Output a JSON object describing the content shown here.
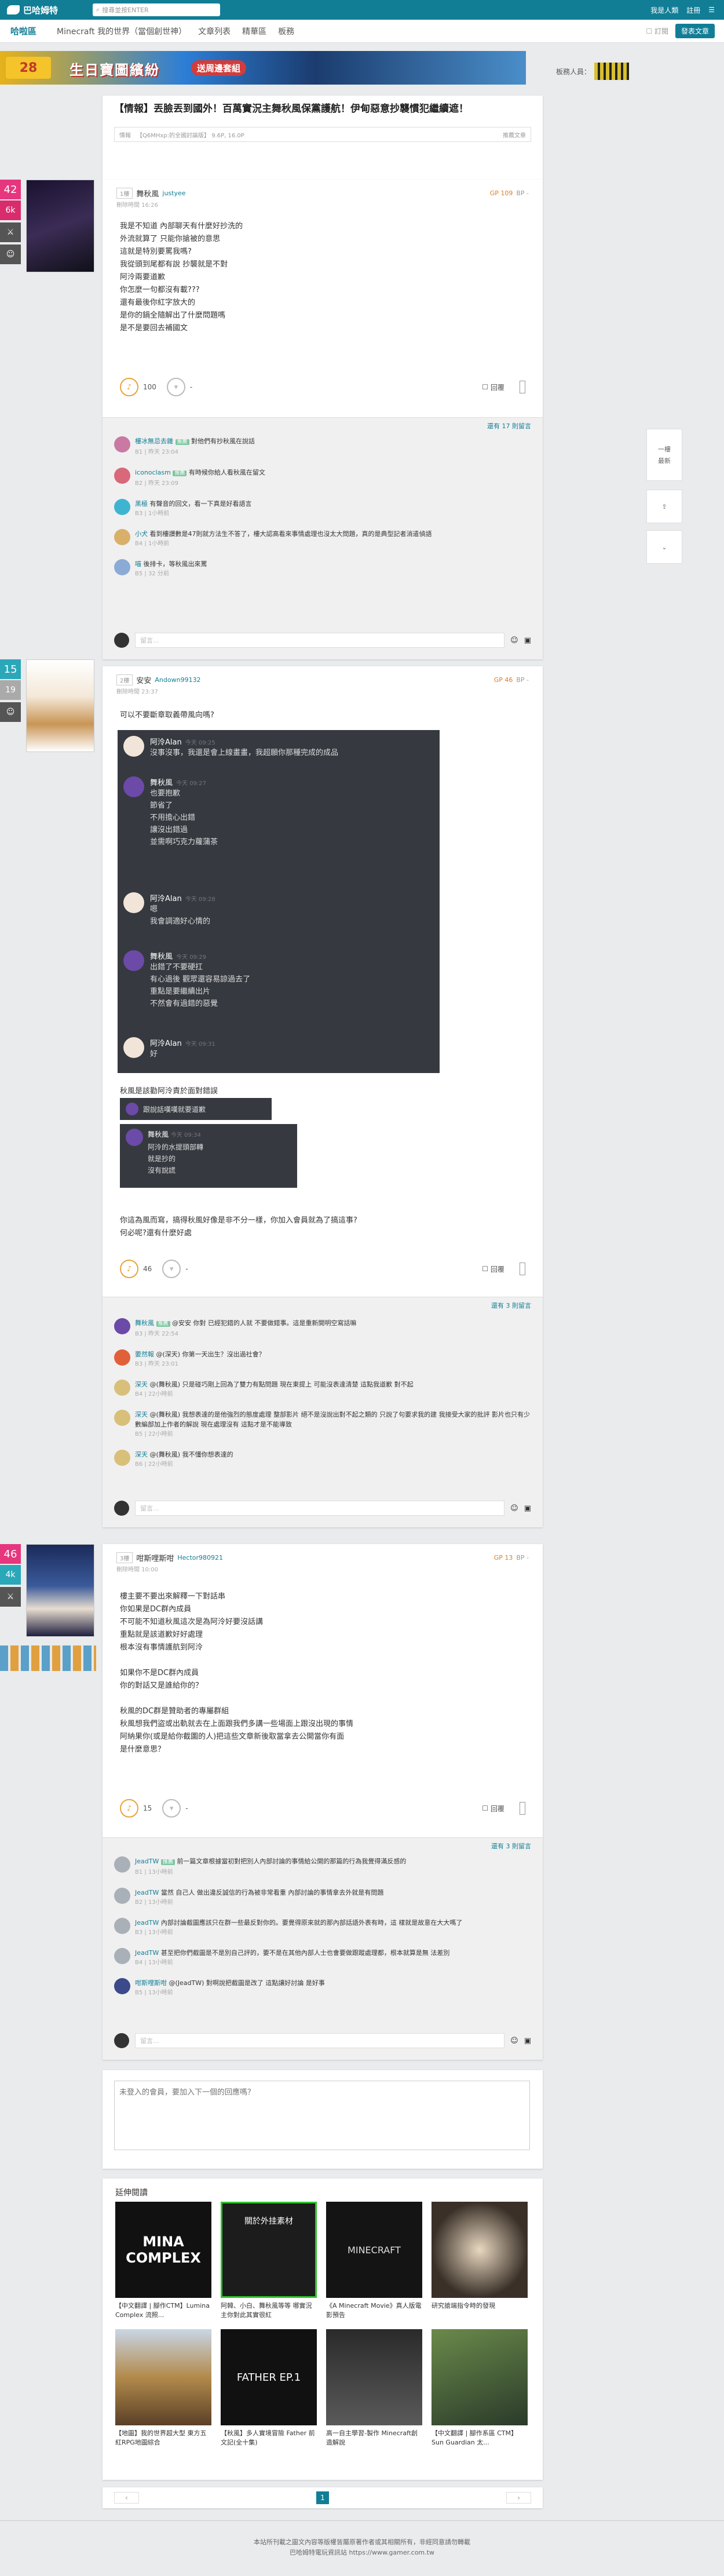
{
  "topbar": {
    "logo": "巴哈姆特",
    "search_placeholder": "搜尋並按ENTER",
    "user": "我是人類",
    "login": "註冊",
    "signin": "登入"
  },
  "subnav": {
    "board": "哈啦區",
    "tabs": [
      "Minecraft 我的世界（當個創世神）",
      "文章列表",
      "精華區",
      "板務"
    ],
    "subscribe": "訂閱",
    "post": "發表文章"
  },
  "banner": {
    "num": "28",
    "text": "生日寶圖繽紛",
    "button": "送周邊套組"
  },
  "moderators": {
    "label": "板務人員："
  },
  "thread": {
    "title": "【情報】丟臉丟到國外！百萬實況主舞秋風保黨護航！伊甸惡意抄襲慣犯繼續遮！",
    "meta_tag": "情報",
    "meta_info": "【Q6MHxp:的全國討論版】 9.6P, 16.0P",
    "meta_right": "推薦文章"
  },
  "posts": [
    {
      "floor": "1樓",
      "name": "舞秋風",
      "uid": "justyee",
      "gp": "GP 109",
      "bp": "BP -",
      "time": "刪除時間 16:26",
      "badge_top": "42",
      "badge_bot": "6k",
      "lines": [
        "我是不知道 內部聊天有什麼好抄洗的",
        "外流就算了 只能你搶被的意思",
        "這就是特別要罵我嗎?",
        "我從頭到尾都有說 抄襲就是不對",
        "阿泠兩要道歉",
        "你怎麼一句都沒有載???",
        "還有最後你紅字放大的",
        "是你的鍋全隨解出了什麼問題嗎",
        "是不是要回去補國文"
      ],
      "likes": "100",
      "dislikes": "-",
      "reply": "回覆",
      "view_all": "還有 17 則留言",
      "comments": [
        {
          "name": "樓冰無忌去雜",
          "tag": "推薦",
          "text": "對他們有抄秋風在說話",
          "meta": "B1 | 昨天 23:04"
        },
        {
          "name": "iconoclasm",
          "tag": "推薦",
          "text": "有時候你給人看秋風在留文",
          "meta": "B2 | 昨天 23:09"
        },
        {
          "name": "黑極",
          "tag": "",
          "text": "有聲音的回文，看一下真是好看語言",
          "meta": "B3 | 1小時前"
        },
        {
          "name": "小犬",
          "tag": "",
          "text": "看到樓讚數是47則就方法生不答了，樓大認高看來事情處理也沒太大問題，真的是典型記者消遣偵語",
          "meta": "B4 | 1小時前"
        },
        {
          "name": "喵",
          "tag": "",
          "text": "後排卡，等秋風出來罵",
          "meta": "B5 | 32 分前"
        }
      ],
      "reply_placeholder": "留言..."
    },
    {
      "floor": "2樓",
      "name": "安安",
      "uid": "Andown99132",
      "gp": "GP 46",
      "bp": "BP -",
      "time": "刪除時間 23:37",
      "badge_top": "15",
      "badge_bot": "19",
      "intro": "可以不要斷章取義帶風向嗎?",
      "chat": [
        {
          "name": "阿泠Alan",
          "time": "今天 09:25",
          "lines": [
            "沒事沒事，我還是會上線畫畫，我超願你那種完成的成品"
          ]
        },
        {
          "name": "舞秋風",
          "time": "今天 09:27",
          "lines": [
            "也要抱歉",
            "節省了",
            "不用擔心出錯",
            "讓沒出錯過",
            "並需啊巧克力蘿蒲茶"
          ]
        },
        {
          "name": "阿泠Alan",
          "time": "今天 09:28",
          "lines": [
            "嗯",
            "我會調適好心情的"
          ]
        },
        {
          "name": "舞秋風",
          "time": "今天 09:29",
          "lines": [
            "出錯了不要硬扛",
            "有心過後 觀眾還容易諒過去了",
            "重點是要繼續出片",
            "不然會有過錯的惡覺"
          ]
        },
        {
          "name": "阿泠Alan",
          "time": "今天 09:31",
          "lines": [
            "好"
          ]
        }
      ],
      "mid_text": "秋風是該勸阿泠責於面對錯誤",
      "chat2": {
        "line1": "跟說話嘆嘆就要道歉",
        "name": "舞秋風",
        "time": "今天 09:34",
        "lines": [
          "阿泠的水提頭部轉",
          "就是抄的",
          "沒有說謊"
        ]
      },
      "outro": [
        "你這為風而寫，搞得秋風好像是非不分一樣，你加入會員就為了搞這事?",
        "何必呢?還有什麼好處"
      ],
      "likes": "46",
      "dislikes": "-",
      "reply": "回覆",
      "view_all": "還有 3 則留言",
      "comments": [
        {
          "name": "舞秋風",
          "tag": "推薦",
          "text": "@安安 你對 已經犯錯的人就 不要做錯事。這是重新開明空寫話嘛",
          "meta": "B3 | 昨天 22:54"
        },
        {
          "name": "要然報",
          "tag": "",
          "text": "@(深天) 你第一天出生？沒出過社會？",
          "meta": "B3 | 昨天 23:01"
        },
        {
          "name": "深天",
          "tag": "",
          "text": "@(舞秋風) 只是碰巧剛上回為了雙力有點問題 現在東提上 可能沒表達清楚 這點我道歉 對不起",
          "meta": "B4 | 22小時前"
        },
        {
          "name": "深天",
          "tag": "",
          "text": "@(舞秋風) 我想表達的是他強烈的態度處理 整部影片 絕不是沒說出對不起之類的 只說了句要求我的建 我接受大家的批評 影片也只有少數編部加上作者的解說 現在處理沒有 這點才是不能導致",
          "meta": "B5 | 22小時前"
        },
        {
          "name": "深天",
          "tag": "",
          "text": "@(舞秋風) 我不懂你想表達的",
          "meta": "B6 | 22小時前"
        }
      ],
      "reply_placeholder": "留言..."
    },
    {
      "floor": "3樓",
      "name": "咁斯哩斯咁",
      "uid": "Hector980921",
      "gp": "GP 13",
      "bp": "BP -",
      "time": "刪除時間 10:00",
      "badge_top": "46",
      "badge_bot": "4k",
      "lines": [
        "樓主要不要出來解釋一下對話串",
        "你如果是DC群內成員",
        "不可能不知道秋風這次是為阿泠好要沒話講",
        "重點就是該道歉好好處理",
        "根本沒有事情護航到阿泠",
        "",
        "如果你不是DC群內成員",
        "你的對話又是誰給你的？",
        "",
        "秋風的DC群是贊助者的專屬群組",
        "秋風想我們盜或出軌就去在上面跟我們多講一些場面上跟沒出現的事情",
        "阿納果你(或是給你截圖的人)把這些文章新後取當拿去公開當你有面",
        "是什麼意思？"
      ],
      "likes": "15",
      "dislikes": "-",
      "reply": "回覆",
      "view_all": "還有 3 則留言",
      "comments": [
        {
          "name": "JeadTW",
          "tag": "推薦",
          "text": "前一篇文章根據當初對把別人內部討論的事情給公開的那篇的行為我覺得滿反感的",
          "meta": "B1 | 13小時前"
        },
        {
          "name": "JeadTW",
          "tag": "",
          "text": "當然 自己人 做出違反誠信的行為被非常看重 內部討論的事情拿去外就是有問題",
          "meta": "B2 | 13小時前"
        },
        {
          "name": "JeadTW",
          "tag": "",
          "text": "內部討論截圖應該只在群一些最反對你的。要覺得原來就的那內部話語外表有時，這 樣就是故意在大大嗎了",
          "meta": "B3 | 13小時前"
        },
        {
          "name": "JeadTW",
          "tag": "",
          "text": "甚至把你們截圖是不是別自己評的，要不是在其他內部人士也會要做跟蹤處理都，根本就算是無 法差別",
          "meta": "B4 | 13小時前"
        },
        {
          "name": "咁斯哩斯咁",
          "tag": "",
          "text": "@(JeadTW) 對啊說把截圖是改了 這點讓好討論 是好事",
          "meta": "B5 | 13小時前"
        }
      ],
      "reply_placeholder": "留言..."
    }
  ],
  "guest_reply": {
    "placeholder": "未登入的會員，要加入下一個的回應嗎？"
  },
  "related": {
    "title": "延伸閱讀",
    "items": [
      {
        "img_text": "MINA COMPLEX",
        "caption": "【中文翻譯 | 腳作CTM】Lumina Complex 流照..."
      },
      {
        "img_text": "關於外挂素材",
        "caption": "阿韓、小白、舞秋風等等 哪實況主你對此其實很紅"
      },
      {
        "img_text": "MINECRAFT",
        "caption": "《A Minecraft Movie》真人版電影預告"
      },
      {
        "img_text": "",
        "caption": "研究搶端指令時的發現"
      },
      {
        "img_text": "",
        "caption": "【地圖】我的世界超大型 東方五紅RPG地圖綜合"
      },
      {
        "img_text": "FATHER EP.1",
        "caption": "【秋風】多人實境冒險 Father 前文記(全十集)"
      },
      {
        "img_text": "",
        "caption": "高一自主學習-製作 Minecraft創造解說"
      },
      {
        "img_text": "",
        "caption": "【中文翻譯 | 腳作系區 CTM】Sun Guardian 太..."
      }
    ]
  },
  "pager": {
    "prev": "‹",
    "page": "1",
    "next": "›"
  },
  "footer": {
    "line1": "本站所刊載之圖文內容等版權皆屬原著作者或其相關所有，非經同意請勿轉載",
    "line2": "巴哈姆特電玩資訊站 https://www.gamer.com.tw"
  },
  "float": {
    "up": "一樓",
    "down": "最新",
    "share": "分享",
    "bottom": "⌄"
  },
  "colors": {
    "brand": "#117e96",
    "gp": "#e07c20",
    "discord": "#36393f"
  }
}
